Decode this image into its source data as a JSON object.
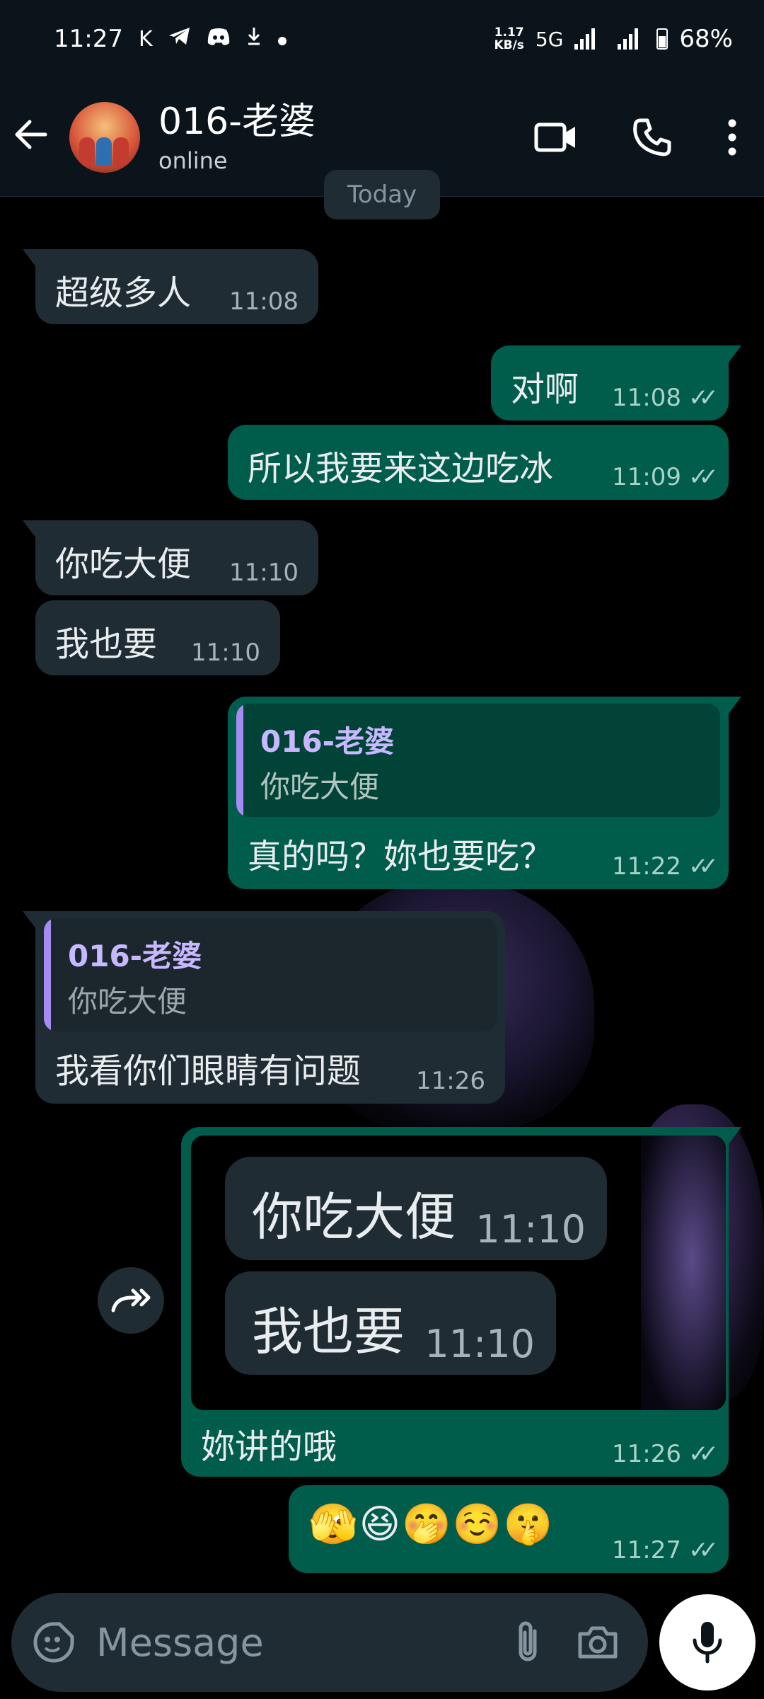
{
  "status_bar": {
    "time": "11:27",
    "net_speed_value": "1.17",
    "net_speed_unit": "KB/s",
    "network": "5G",
    "battery": "68%",
    "battery_level": 0.68
  },
  "header": {
    "contact_name": "016-老婆",
    "contact_status": "online"
  },
  "date_chip": "Today",
  "messages": [
    {
      "dir": "in",
      "text": "超级多人",
      "time": "11:08"
    },
    {
      "dir": "out",
      "text": "对啊",
      "time": "11:08"
    },
    {
      "dir": "out",
      "text": "所以我要来这边吃冰",
      "time": "11:09"
    },
    {
      "dir": "in",
      "text": "你吃大便",
      "time": "11:10"
    },
    {
      "dir": "in",
      "text": "我也要",
      "time": "11:10"
    },
    {
      "dir": "out",
      "quote_name": "016-老婆",
      "quote_text": "你吃大便",
      "text": "真的吗？妳也要吃？",
      "time": "11:22"
    },
    {
      "dir": "in",
      "quote_name": "016-老婆",
      "quote_text": "你吃大便",
      "text": "我看你们眼睛有问题",
      "time": "11:26"
    },
    {
      "dir": "out",
      "image_bubbles": [
        {
          "text": "你吃大便",
          "time": "11:10"
        },
        {
          "text": "我也要",
          "time": "11:10"
        }
      ],
      "text": "妳讲的哦",
      "time": "11:26"
    },
    {
      "dir": "out",
      "text": "🫣😆🤭☺️🤫",
      "time": "11:27"
    }
  ],
  "input": {
    "placeholder": "Message"
  }
}
